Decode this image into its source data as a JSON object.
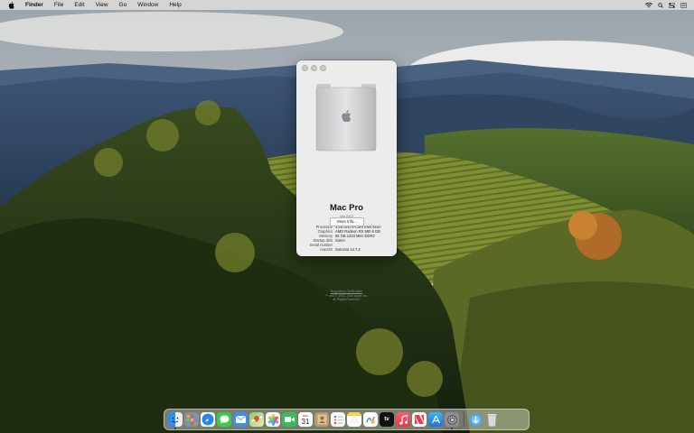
{
  "menubar": {
    "app_name": "Finder",
    "menus": [
      "File",
      "Edit",
      "View",
      "Go",
      "Window",
      "Help"
    ]
  },
  "about": {
    "title": "Mac Pro",
    "subtitle": "Mid 2012",
    "specs": [
      {
        "label": "Processor",
        "value": "3.46 GHz 6-Core Intel Xeon"
      },
      {
        "label": "Graphics",
        "value": "AMD Radeon RX 580 8 GB"
      },
      {
        "label": "Memory",
        "value": "56 GB 1333 MHz DDR3"
      },
      {
        "label": "Startup disk",
        "value": "Sonm"
      },
      {
        "label": "Serial number",
        "value": ""
      },
      {
        "label": "macOS",
        "value": "Sonoma 14.7.2"
      }
    ],
    "more_info_label": "More Info...",
    "footer_link": "Regulatory Certification",
    "footer_line1": "™ and © 1983–2024 Apple Inc.",
    "footer_line2": "All Rights Reserved."
  },
  "dock": {
    "apps": [
      {
        "name": "finder-icon",
        "color": "#2e8ef0",
        "running": true
      },
      {
        "name": "launchpad-icon",
        "color": "#8a8fa0",
        "running": false
      },
      {
        "name": "safari-icon",
        "color": "#1d8cf0",
        "running": false
      },
      {
        "name": "messages-icon",
        "color": "#3fc951",
        "running": false
      },
      {
        "name": "mail-icon",
        "color": "#3a8ff2",
        "running": false
      },
      {
        "name": "maps-icon",
        "color": "#5cbf5a",
        "running": false
      },
      {
        "name": "photos-icon",
        "color": "#f5f5f5",
        "running": false
      },
      {
        "name": "facetime-icon",
        "color": "#33c05a",
        "running": false
      },
      {
        "name": "calendar-icon",
        "color": "#ffffff",
        "running": false
      },
      {
        "name": "contacts-icon",
        "color": "#b89a6a",
        "running": false
      },
      {
        "name": "reminders-icon",
        "color": "#fafafa",
        "running": false
      },
      {
        "name": "notes-icon",
        "color": "#f7e27a",
        "running": false
      },
      {
        "name": "freeform-icon",
        "color": "#ffffff",
        "running": false
      },
      {
        "name": "apple-tv-icon",
        "color": "#111111",
        "running": false
      },
      {
        "name": "music-icon",
        "color": "#fa3c55",
        "running": false
      },
      {
        "name": "news-icon",
        "color": "#ffffff",
        "running": false
      },
      {
        "name": "app-store-icon",
        "color": "#1f8ff5",
        "running": false
      },
      {
        "name": "system-settings-icon",
        "color": "#8e8e93",
        "running": true
      }
    ],
    "right_apps": [
      {
        "name": "downloads-folder-icon",
        "color": "#4aa3ef"
      },
      {
        "name": "trash-icon",
        "color": "#dcdcdc"
      }
    ],
    "calendar_day": "31",
    "calendar_month": "DEC",
    "tv_label": "tv"
  }
}
